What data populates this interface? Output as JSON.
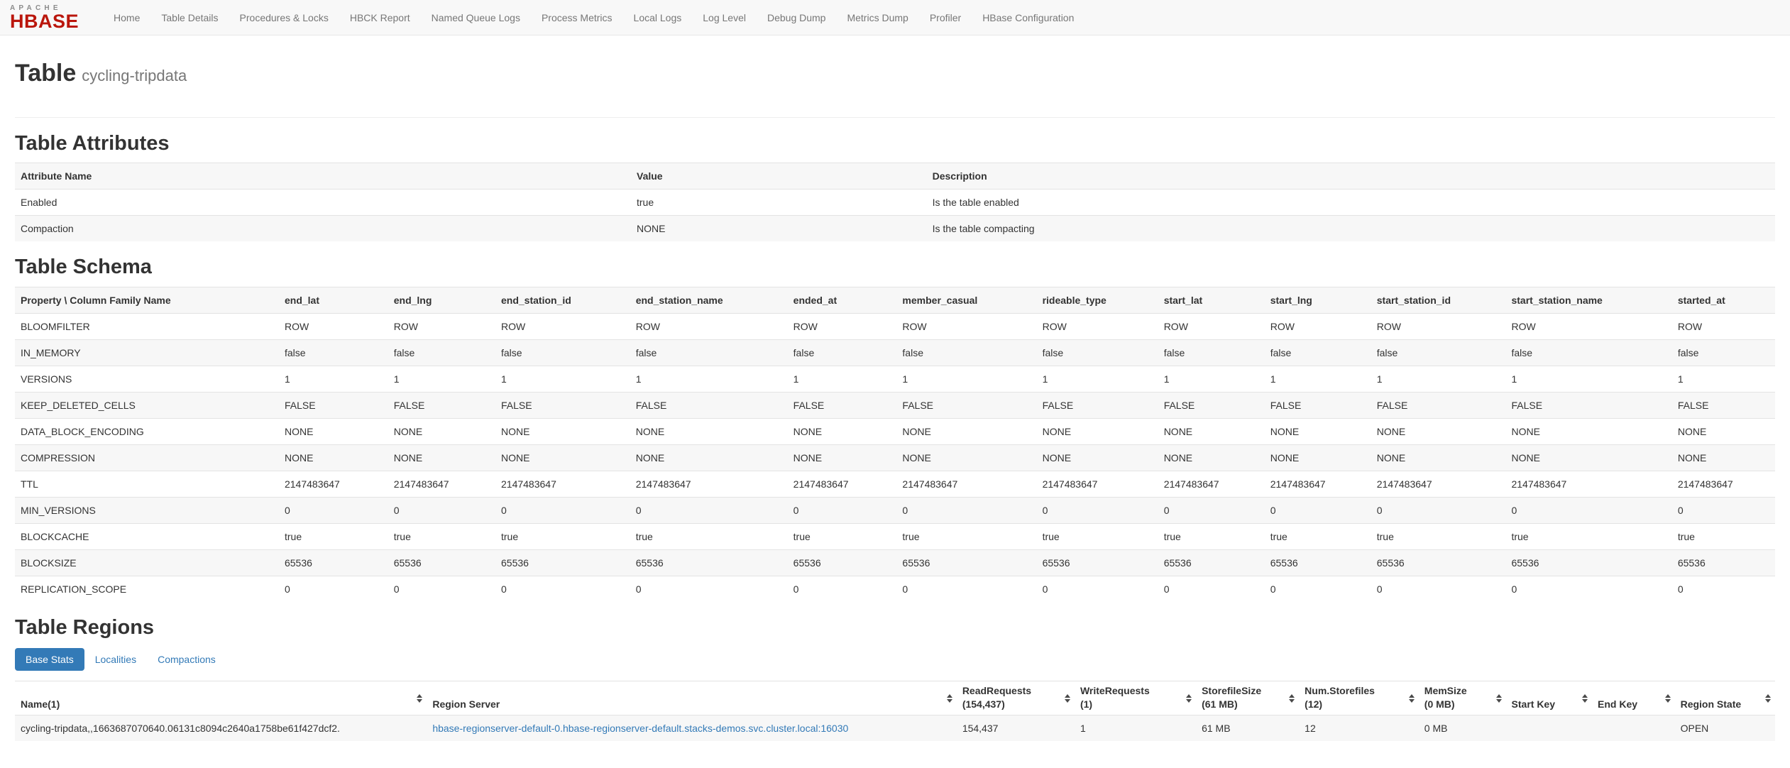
{
  "colors": {
    "brand_red": "#ba160c",
    "accent_blue": "#337ab7"
  },
  "nav": {
    "brand_top": "APACHE",
    "brand_bottom": "HBASE",
    "items": [
      "Home",
      "Table Details",
      "Procedures & Locks",
      "HBCK Report",
      "Named Queue Logs",
      "Process Metrics",
      "Local Logs",
      "Log Level",
      "Debug Dump",
      "Metrics Dump",
      "Profiler",
      "HBase Configuration"
    ]
  },
  "page": {
    "title": "Table",
    "subtitle": "cycling-tripdata"
  },
  "attributes": {
    "heading": "Table Attributes",
    "columns": [
      "Attribute Name",
      "Value",
      "Description"
    ],
    "rows": [
      {
        "name": "Enabled",
        "value": "true",
        "description": "Is the table enabled"
      },
      {
        "name": "Compaction",
        "value": "NONE",
        "description": "Is the table compacting"
      }
    ]
  },
  "schema": {
    "heading": "Table Schema",
    "corner": "Property \\ Column Family Name",
    "families": [
      "end_lat",
      "end_lng",
      "end_station_id",
      "end_station_name",
      "ended_at",
      "member_casual",
      "rideable_type",
      "start_lat",
      "start_lng",
      "start_station_id",
      "start_station_name",
      "started_at"
    ],
    "rows": [
      {
        "property": "BLOOMFILTER",
        "value": "ROW"
      },
      {
        "property": "IN_MEMORY",
        "value": "false"
      },
      {
        "property": "VERSIONS",
        "value": "1"
      },
      {
        "property": "KEEP_DELETED_CELLS",
        "value": "FALSE"
      },
      {
        "property": "DATA_BLOCK_ENCODING",
        "value": "NONE"
      },
      {
        "property": "COMPRESSION",
        "value": "NONE"
      },
      {
        "property": "TTL",
        "value": "2147483647"
      },
      {
        "property": "MIN_VERSIONS",
        "value": "0"
      },
      {
        "property": "BLOCKCACHE",
        "value": "true"
      },
      {
        "property": "BLOCKSIZE",
        "value": "65536"
      },
      {
        "property": "REPLICATION_SCOPE",
        "value": "0"
      }
    ]
  },
  "regions": {
    "heading": "Table Regions",
    "tabs": [
      {
        "label": "Base Stats",
        "active": true
      },
      {
        "label": "Localities",
        "active": false
      },
      {
        "label": "Compactions",
        "active": false
      }
    ],
    "columns": [
      {
        "lines": [
          "Name(1)"
        ]
      },
      {
        "lines": [
          "Region Server"
        ]
      },
      {
        "lines": [
          "ReadRequests",
          "(154,437)"
        ]
      },
      {
        "lines": [
          "WriteRequests",
          "(1)"
        ]
      },
      {
        "lines": [
          "StorefileSize",
          "(61 MB)"
        ]
      },
      {
        "lines": [
          "Num.Storefiles",
          "(12)"
        ]
      },
      {
        "lines": [
          "MemSize",
          "(0 MB)"
        ]
      },
      {
        "lines": [
          "Start Key"
        ]
      },
      {
        "lines": [
          "End Key"
        ]
      },
      {
        "lines": [
          "Region State"
        ]
      }
    ],
    "rows": [
      {
        "name": "cycling-tripdata,,1663687070640.06131c8094c2640a1758be61f427dcf2.",
        "server": "hbase-regionserver-default-0.hbase-regionserver-default.stacks-demos.svc.cluster.local:16030",
        "read_requests": "154,437",
        "write_requests": "1",
        "storefile_size": "61 MB",
        "num_storefiles": "12",
        "mem_size": "0 MB",
        "start_key": "",
        "end_key": "",
        "region_state": "OPEN"
      }
    ]
  }
}
